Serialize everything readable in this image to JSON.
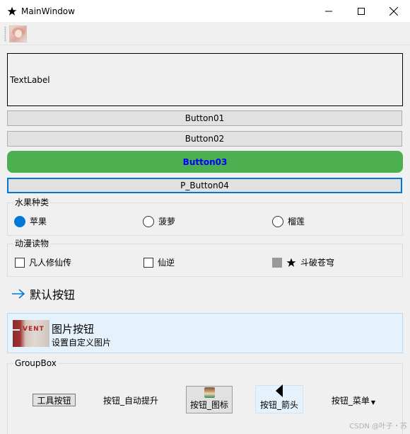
{
  "window": {
    "title": "MainWindow",
    "icon": "star-icon",
    "controls": {
      "minimize": "minimize-icon",
      "maximize": "maximize-icon",
      "close": "close-icon"
    }
  },
  "toolbar": {
    "image_action_icon": "portrait-image-icon"
  },
  "main": {
    "text_label": "TextLabel",
    "button01": "Button01",
    "button02": "Button02",
    "button03": "Button03",
    "button04": "P_Button04",
    "button03_bg": "#4caf50",
    "button03_text_color": "#0000ff"
  },
  "fruit_group": {
    "title": "水果种类",
    "options": [
      {
        "label": "苹果",
        "checked": true
      },
      {
        "label": "菠萝",
        "checked": false
      },
      {
        "label": "榴莲",
        "checked": false
      }
    ]
  },
  "anime_group": {
    "title": "动漫读物",
    "options": [
      {
        "label": "凡人修仙传",
        "state": "unchecked"
      },
      {
        "label": "仙逆",
        "state": "unchecked"
      },
      {
        "label": "斗破苍穹",
        "state": "partial",
        "icon": "star-icon"
      }
    ]
  },
  "command_link": {
    "label": "默认按钮",
    "icon": "arrow-right-icon",
    "accent": "#0078d7"
  },
  "image_button": {
    "title": "图片按钮",
    "subtitle": "设置自定义图片",
    "thumb_text": "VENT"
  },
  "groupbox": {
    "title": "GroupBox",
    "tool_buttons": [
      {
        "label": "工具按钮"
      },
      {
        "label": "按钮_自动提升"
      },
      {
        "label": "按钮_图标",
        "icon": "picture-icon"
      },
      {
        "label": "按钮_箭头",
        "icon": "left-arrow-icon"
      },
      {
        "label": "按钮_菜单",
        "icon": "dropdown-caret-icon"
      }
    ]
  },
  "watermark": "CSDN @叶子・苏"
}
